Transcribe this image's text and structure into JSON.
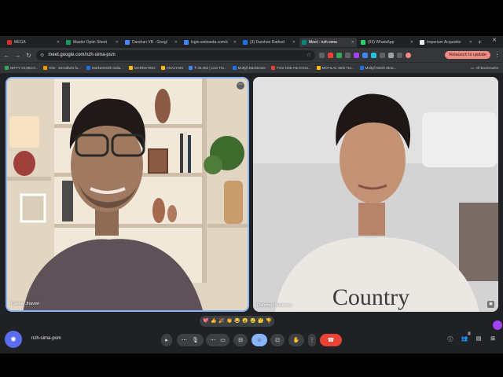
{
  "browser": {
    "tabs": [
      {
        "label": "MEGA",
        "color": "#d93025"
      },
      {
        "label": "Master Optin Sheet",
        "color": "#0f9d58"
      },
      {
        "label": "Darshan VB - Googl",
        "color": "#4285f4"
      },
      {
        "label": "login.weboeda.com/s",
        "color": "#4285f4"
      },
      {
        "label": "(3) Darshan Rathod",
        "color": "#1a73e8"
      },
      {
        "label": "Meet - nzh-sima",
        "color": "#00897b",
        "active": true
      },
      {
        "label": "(93) WhatsApp",
        "color": "#25d366"
      },
      {
        "label": "Imperium Acquisitio",
        "color": "#e8eaed"
      }
    ],
    "url": "meet.google.com/nzh-sima-psm",
    "relaunch_label": "Relaunch to update",
    "bookmarks": [
      {
        "label": "NIFTY 24,683.0...",
        "color": "#34a853"
      },
      {
        "label": "Kite - Zerodha's fa...",
        "color": "#f29900"
      },
      {
        "label": "MarketSmith India...",
        "color": "#1a73e8"
      },
      {
        "label": "MARKETING",
        "color": "#fbbc04"
      },
      {
        "label": "ANALYSIS",
        "color": "#fbbc04"
      },
      {
        "label": "₹ 25,462 | Live Tra...",
        "color": "#4285f4"
      },
      {
        "label": "Multyfi Backtester",
        "color": "#1a73e8"
      },
      {
        "label": "Free NSE F& OI Da...",
        "color": "#ea4335"
      },
      {
        "label": "MOTILAL Web Tra...",
        "color": "#fbbc04"
      },
      {
        "label": "Multyfi Mesh Strat...",
        "color": "#1a73e8"
      }
    ],
    "all_bookmarks_label": "All Bookmarks"
  },
  "meet": {
    "participants": [
      {
        "name": "Kushal Jhaveri"
      },
      {
        "name": "Darshan Business"
      }
    ],
    "reactions": [
      "💖",
      "👍",
      "🎉",
      "👏",
      "😂",
      "😮",
      "😢",
      "🤔",
      "👎"
    ],
    "meeting_code": "nzh-sima-psm",
    "people_count": "2"
  },
  "colors": {
    "accent": "#8ab4f8",
    "end_call": "#ea4335",
    "control_bg": "#3c4043",
    "meet_bg": "#202124"
  }
}
